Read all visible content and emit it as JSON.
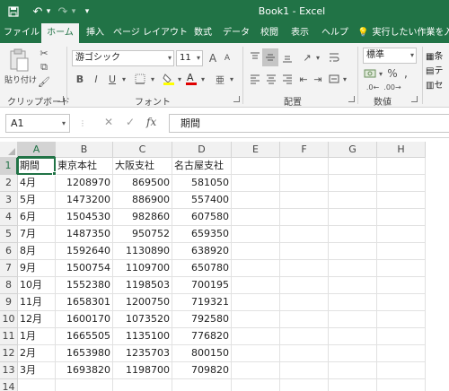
{
  "app": {
    "title": "Book1  -  Excel",
    "accent_color": "#217346"
  },
  "quick_access": [
    {
      "name": "save-icon",
      "glyph": "💾"
    },
    {
      "name": "undo-icon",
      "glyph": "↶"
    },
    {
      "name": "undo-dropdown-icon",
      "glyph": "▾"
    },
    {
      "name": "redo-icon",
      "glyph": "↷"
    },
    {
      "name": "redo-dropdown-icon",
      "glyph": "▾"
    },
    {
      "name": "customize-qat-icon",
      "glyph": "▾"
    }
  ],
  "tabs": [
    {
      "label": "ファイル",
      "active": false
    },
    {
      "label": "ホーム",
      "active": true
    },
    {
      "label": "挿入",
      "active": false
    },
    {
      "label": "ページ レイアウト",
      "active": false
    },
    {
      "label": "数式",
      "active": false
    },
    {
      "label": "データ",
      "active": false
    },
    {
      "label": "校閲",
      "active": false
    },
    {
      "label": "表示",
      "active": false
    },
    {
      "label": "ヘルプ",
      "active": false
    }
  ],
  "tell_me": {
    "icon": "lightbulb-icon",
    "text": "実行したい作業を入"
  },
  "ribbon": {
    "clipboard": {
      "label": "クリップボード",
      "paste_label": "貼り付け"
    },
    "font": {
      "label": "フォント",
      "family": "游ゴシック",
      "size": "11",
      "bold": "B",
      "italic": "I",
      "underline": "U"
    },
    "alignment": {
      "label": "配置"
    },
    "number": {
      "label": "数値",
      "format": "標準",
      "percent": "%",
      "comma": ","
    },
    "styles": {
      "items": [
        "条",
        "テ",
        "セ"
      ]
    }
  },
  "formula_bar": {
    "name_box": "A1",
    "cancel": "✕",
    "enter": "✓",
    "fx": "fx",
    "content": "期間"
  },
  "sheet": {
    "columns": [
      "A",
      "B",
      "C",
      "D",
      "E",
      "F",
      "G",
      "H"
    ],
    "selected_column": "A",
    "selected_row": 1,
    "rows": [
      {
        "n": "1",
        "cells": [
          "期間",
          "東京本社",
          "大阪支社",
          "名古屋支社"
        ]
      },
      {
        "n": "2",
        "cells": [
          "4月",
          "1208970",
          "869500",
          "581050"
        ]
      },
      {
        "n": "3",
        "cells": [
          "5月",
          "1473200",
          "886900",
          "557400"
        ]
      },
      {
        "n": "4",
        "cells": [
          "6月",
          "1504530",
          "982860",
          "607580"
        ]
      },
      {
        "n": "5",
        "cells": [
          "7月",
          "1487350",
          "950752",
          "659350"
        ]
      },
      {
        "n": "6",
        "cells": [
          "8月",
          "1592640",
          "1130890",
          "638920"
        ]
      },
      {
        "n": "7",
        "cells": [
          "9月",
          "1500754",
          "1109700",
          "650780"
        ]
      },
      {
        "n": "8",
        "cells": [
          "10月",
          "1552380",
          "1198503",
          "700195"
        ]
      },
      {
        "n": "9",
        "cells": [
          "11月",
          "1658301",
          "1200750",
          "719321"
        ]
      },
      {
        "n": "10",
        "cells": [
          "12月",
          "1600170",
          "1073520",
          "792580"
        ]
      },
      {
        "n": "11",
        "cells": [
          "1月",
          "1665505",
          "1135100",
          "776820"
        ]
      },
      {
        "n": "12",
        "cells": [
          "2月",
          "1653980",
          "1235703",
          "800150"
        ]
      },
      {
        "n": "13",
        "cells": [
          "3月",
          "1693820",
          "1198700",
          "709820"
        ]
      },
      {
        "n": "14",
        "cells": [
          "",
          "",
          "",
          ""
        ]
      }
    ]
  }
}
